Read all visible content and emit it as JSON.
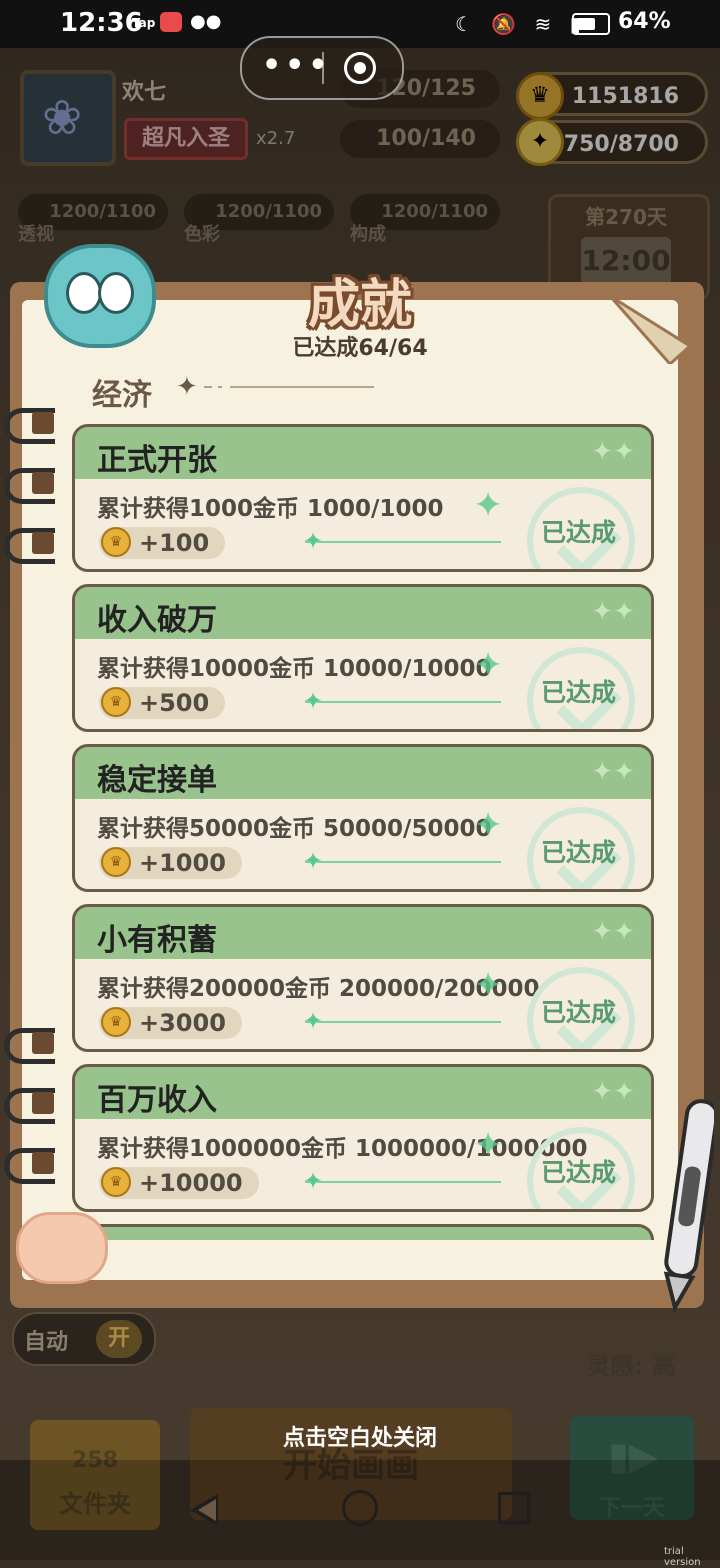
{
  "status_bar": {
    "time": "12:36",
    "tap_label": "Tap",
    "battery": "64%"
  },
  "hud": {
    "player_name": "欢七",
    "player_title": "超凡入圣",
    "multiplier": "x2.7",
    "bar1": "120/125",
    "bar2": "100/140",
    "coins": "1151816",
    "inspiration": "750/8700",
    "stats": [
      {
        "label": "透视",
        "value": "1200/1100"
      },
      {
        "label": "色彩",
        "value": "1200/1100"
      },
      {
        "label": "构成",
        "value": "1200/1100"
      }
    ],
    "day": "第270天",
    "clock": "12:00"
  },
  "panel": {
    "title": "成就",
    "progress": "已达成64/64",
    "category": "经济",
    "items": [
      {
        "name": "正式开张",
        "desc": "累计获得1000金币 1000/1000",
        "reward": "+100",
        "status": "已达成"
      },
      {
        "name": "收入破万",
        "desc": "累计获得10000金币 10000/10000",
        "reward": "+500",
        "status": "已达成"
      },
      {
        "name": "稳定接单",
        "desc": "累计获得50000金币 50000/50000",
        "reward": "+1000",
        "status": "已达成"
      },
      {
        "name": "小有积蓄",
        "desc": "累计获得200000金币 200000/200000",
        "reward": "+3000",
        "status": "已达成"
      },
      {
        "name": "百万收入",
        "desc": "累计获得1000000金币 1000000/1000000",
        "reward": "+10000",
        "status": "已达成"
      }
    ]
  },
  "bottom": {
    "auto_label": "自动",
    "auto_toggle": "开",
    "inspiration_label": "灵感: 高",
    "folder_count": "258",
    "folder_label": "文件夹",
    "start_label": "开始画画",
    "next_label": "下一天",
    "close_hint": "点击空白处关闭"
  },
  "watermark": "trial version",
  "colors": {
    "card_header": "#98c38d",
    "card_body": "#f4ecdc",
    "done_text": "#5a9a6f",
    "title_outline": "#7b4b2d"
  }
}
